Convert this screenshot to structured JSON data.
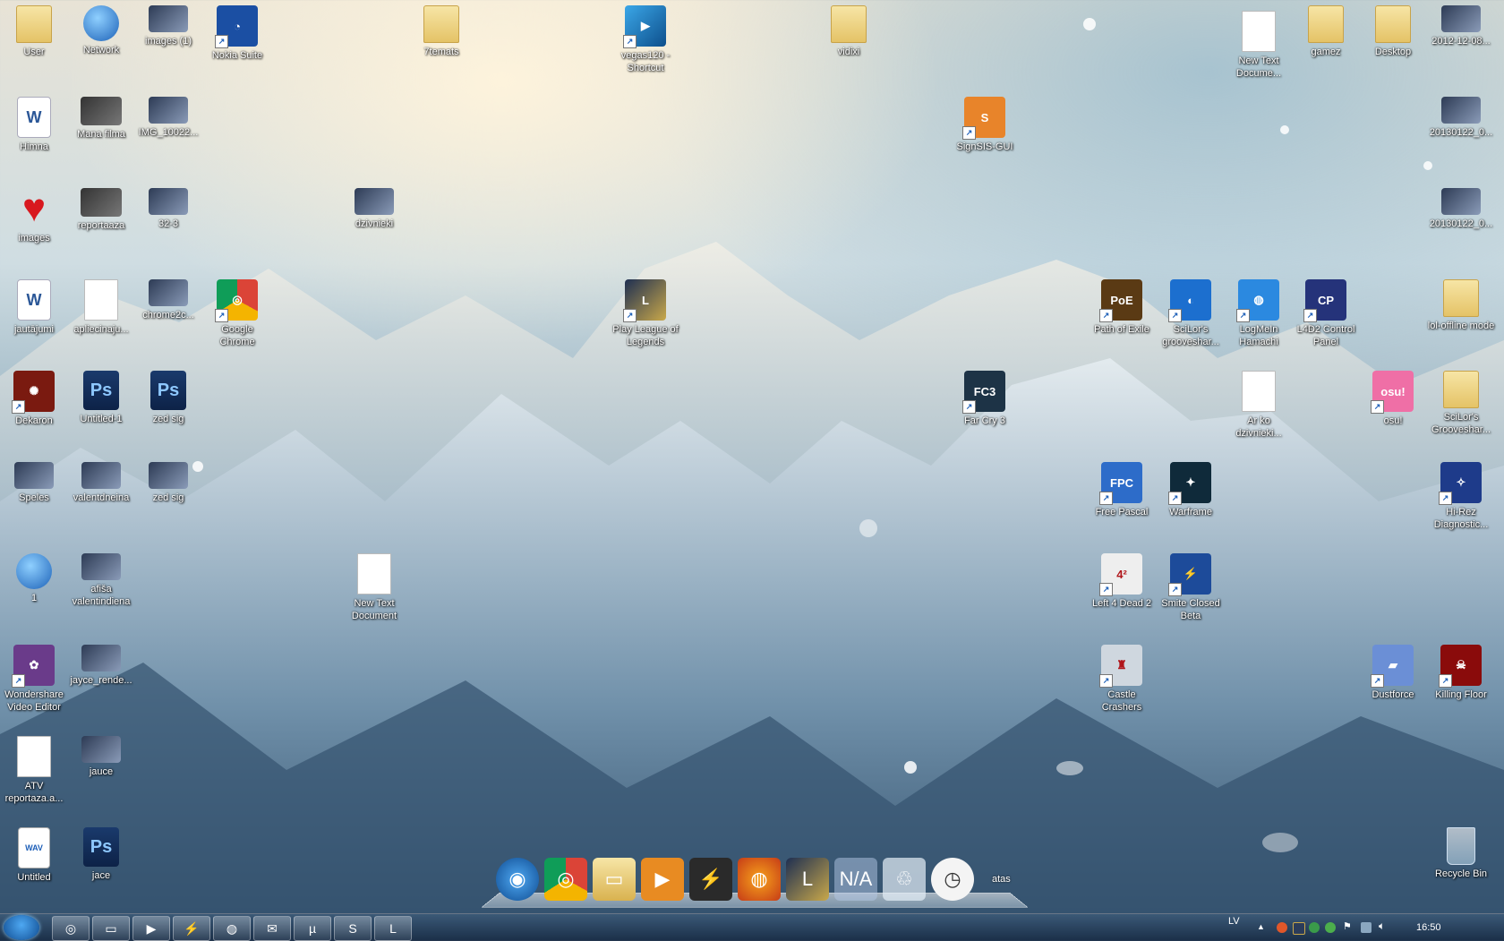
{
  "desktop": {
    "icons": [
      {
        "id": "user",
        "label": "User",
        "icon": "user-folder-icon"
      },
      {
        "id": "network",
        "label": "Network",
        "icon": "network-icon"
      },
      {
        "id": "images1",
        "label": "images (1)",
        "icon": "image-icon"
      },
      {
        "id": "nokia",
        "label": "Nokia Suite",
        "icon": "nokia-suite-icon"
      },
      {
        "id": "7temats",
        "label": "7temats",
        "icon": "folder-icon"
      },
      {
        "id": "vegas",
        "label": "vegas120 - Shortcut",
        "icon": "vegas-icon"
      },
      {
        "id": "vidixi",
        "label": "vidixi",
        "icon": "folder-icon"
      },
      {
        "id": "newtext1",
        "label": "New Text Docume...",
        "icon": "text-document-icon"
      },
      {
        "id": "gamez",
        "label": "gamez",
        "icon": "folder-icon"
      },
      {
        "id": "desktop",
        "label": "Desktop",
        "icon": "folder-icon"
      },
      {
        "id": "img2012",
        "label": "2012-12-08...",
        "icon": "image-icon"
      },
      {
        "id": "himna",
        "label": "Himna",
        "icon": "word-document-icon"
      },
      {
        "id": "manafilma",
        "label": "Mana filma",
        "icon": "movie-icon"
      },
      {
        "id": "img10022",
        "label": "IMG_10022...",
        "icon": "image-icon"
      },
      {
        "id": "signsis",
        "label": "SignSIS-GUI",
        "icon": "signsis-icon"
      },
      {
        "id": "img20130122a",
        "label": "20130122_0...",
        "icon": "image-icon"
      },
      {
        "id": "images",
        "label": "images",
        "icon": "heart-icon"
      },
      {
        "id": "reportaaza",
        "label": "reportaaza",
        "icon": "movie-icon"
      },
      {
        "id": "32-3",
        "label": "32-3",
        "icon": "image-icon"
      },
      {
        "id": "dzivnieki",
        "label": "dzivnieki",
        "icon": "powerpoint-icon"
      },
      {
        "id": "img20130122b",
        "label": "20130122_0...",
        "icon": "image-icon"
      },
      {
        "id": "jautajumi",
        "label": "jautājumi",
        "icon": "word-document-icon"
      },
      {
        "id": "apliecinaju",
        "label": "apliecinaju...",
        "icon": "document-icon"
      },
      {
        "id": "chrome2c",
        "label": "chrome2c...",
        "icon": "image-icon"
      },
      {
        "id": "chrome",
        "label": "Google Chrome",
        "icon": "chrome-icon"
      },
      {
        "id": "lol",
        "label": "Play League of Legends",
        "icon": "league-of-legends-icon"
      },
      {
        "id": "poe",
        "label": "Path of Exile",
        "icon": "path-of-exile-icon"
      },
      {
        "id": "grooveshark",
        "label": "SciLor's grooveshar...",
        "icon": "grooveshark-icon"
      },
      {
        "id": "hamachi",
        "label": "LogMeIn Hamachi",
        "icon": "hamachi-icon"
      },
      {
        "id": "l4d2cp",
        "label": "L4D2 Control Panel",
        "icon": "l4d2-control-panel-icon"
      },
      {
        "id": "loloffline",
        "label": "lol-offline mode",
        "icon": "folder-icon"
      },
      {
        "id": "dekaron",
        "label": "Dekaron",
        "icon": "dekaron-icon"
      },
      {
        "id": "untitled1",
        "label": "Untitled-1",
        "icon": "photoshop-icon"
      },
      {
        "id": "zedsig1",
        "label": "zed sig",
        "icon": "photoshop-icon"
      },
      {
        "id": "farcry3",
        "label": "Far Cry 3",
        "icon": "far-cry-3-icon"
      },
      {
        "id": "arko",
        "label": "Ar ko dzivnieki...",
        "icon": "calendar-document-icon"
      },
      {
        "id": "osu",
        "label": "osu!",
        "icon": "osu-icon"
      },
      {
        "id": "grooveshar2",
        "label": "SciLor's Grooveshar...",
        "icon": "folder-icon"
      },
      {
        "id": "speles",
        "label": "Speles",
        "icon": "image-icon"
      },
      {
        "id": "valentdienai",
        "label": "valentdneina",
        "icon": "image-icon"
      },
      {
        "id": "zedsig2",
        "label": "zed sig",
        "icon": "image-icon"
      },
      {
        "id": "freepascal",
        "label": "Free Pascal",
        "icon": "free-pascal-icon"
      },
      {
        "id": "warframe",
        "label": "Warframe",
        "icon": "warframe-icon"
      },
      {
        "id": "hirez",
        "label": "Hi-Rez Diagnostic...",
        "icon": "hi-rez-icon"
      },
      {
        "id": "one",
        "label": "1",
        "icon": "globe-icon"
      },
      {
        "id": "afisa",
        "label": "afiša valentindiena",
        "icon": "image-icon"
      },
      {
        "id": "newtext2",
        "label": "New Text Document",
        "icon": "text-document-icon"
      },
      {
        "id": "l4d2",
        "label": "Left 4 Dead 2",
        "icon": "left-4-dead-2-icon"
      },
      {
        "id": "smite",
        "label": "Smite Closed Beta",
        "icon": "smite-icon"
      },
      {
        "id": "wondershare",
        "label": "Wondershare Video Editor",
        "icon": "wondershare-icon"
      },
      {
        "id": "jayce_render",
        "label": "jayce_rende...",
        "icon": "image-icon"
      },
      {
        "id": "castle",
        "label": "Castle Crashers",
        "icon": "castle-crashers-icon"
      },
      {
        "id": "dustforce",
        "label": "Dustforce",
        "icon": "dustforce-icon"
      },
      {
        "id": "killingfloor",
        "label": "Killing Floor",
        "icon": "killing-floor-icon"
      },
      {
        "id": "atv",
        "label": "ATV reportaza.a...",
        "icon": "text-document-icon"
      },
      {
        "id": "jauce",
        "label": "jauce",
        "icon": "image-icon"
      },
      {
        "id": "untitledwav",
        "label": "Untitled",
        "icon": "wav-file-icon"
      },
      {
        "id": "jace",
        "label": "jace",
        "icon": "photoshop-icon"
      },
      {
        "id": "recycle",
        "label": "Recycle Bin",
        "icon": "recycle-bin-icon"
      }
    ]
  },
  "dock": {
    "items": [
      {
        "name": "start-orb",
        "glyph": "◉"
      },
      {
        "name": "chrome",
        "glyph": "◎"
      },
      {
        "name": "explorer",
        "glyph": "▭"
      },
      {
        "name": "media-player",
        "glyph": "▶"
      },
      {
        "name": "winamp",
        "glyph": "⚡"
      },
      {
        "name": "firefox",
        "glyph": "◍"
      },
      {
        "name": "league-of-legends",
        "glyph": "L"
      },
      {
        "name": "n-a",
        "glyph": "N/A"
      },
      {
        "name": "recycle-bin",
        "glyph": "♲"
      },
      {
        "name": "clock",
        "glyph": "◷"
      }
    ],
    "trailing_text": "atas"
  },
  "taskbar": {
    "buttons": [
      {
        "name": "chrome",
        "glyph": "◎"
      },
      {
        "name": "explorer",
        "glyph": "▭"
      },
      {
        "name": "media-player",
        "glyph": "▶"
      },
      {
        "name": "winamp",
        "glyph": "⚡"
      },
      {
        "name": "firefox",
        "glyph": "◍"
      },
      {
        "name": "chat",
        "glyph": "✉"
      },
      {
        "name": "utorrent",
        "glyph": "µ"
      },
      {
        "name": "skype",
        "glyph": "S"
      },
      {
        "name": "league-of-legends",
        "glyph": "L"
      }
    ],
    "language": "LV",
    "clock": "16:50"
  }
}
